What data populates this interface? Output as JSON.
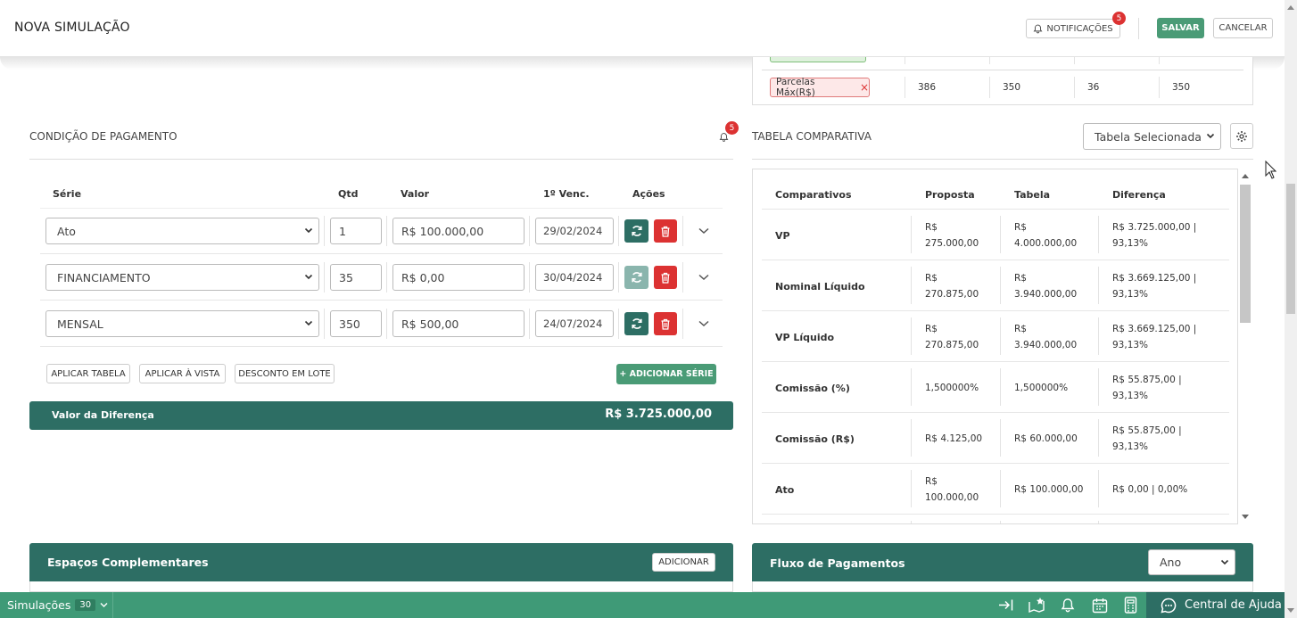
{
  "header": {
    "title": "NOVA SIMULAÇÃO",
    "notifications_label": "NOTIFICAÇÕES",
    "notifications_count": "5",
    "save_label": "SALVAR",
    "cancel_label": "CANCELAR"
  },
  "filters": {
    "chip_label": "Parcelas Máx(R$)",
    "chip_remove": "×",
    "values": [
      "386",
      "350",
      "36",
      "350"
    ]
  },
  "payment": {
    "title": "CONDIÇÃO DE PAGAMENTO",
    "bell_count": "5",
    "columns": {
      "serie": "Série",
      "qtd": "Qtd",
      "valor": "Valor",
      "venc": "1º Venc.",
      "acoes": "Ações"
    },
    "rows": [
      {
        "serie": "Ato",
        "qtd": "1",
        "valor": "R$ 100.000,00",
        "venc": "29/02/2024"
      },
      {
        "serie": "FINANCIAMENTO",
        "qtd": "35",
        "valor": "R$ 0,00",
        "venc": "30/04/2024"
      },
      {
        "serie": "MENSAL",
        "qtd": "350",
        "valor": "R$ 500,00",
        "venc": "24/07/2024"
      }
    ],
    "apply_table_label": "APLICAR TABELA",
    "apply_cash_label": "APLICAR À VISTA",
    "batch_discount_label": "DESCONTO EM LOTE",
    "add_series_label": "+ ADICIONAR SÉRIE",
    "difference_label": "Valor da Diferença",
    "difference_value": "R$ 3.725.000,00"
  },
  "comparison": {
    "title": "TABELA COMPARATIVA",
    "select_value": "Tabela Selecionada",
    "columns": {
      "c1": "Comparativos",
      "c2": "Proposta",
      "c3": "Tabela",
      "c4": "Diferença"
    },
    "rows": [
      {
        "label": "VP",
        "proposta": [
          "R$",
          "275.000,00"
        ],
        "tabela": [
          "R$",
          "4.000.000,00"
        ],
        "diferenca": [
          "R$ 3.725.000,00 |",
          "93,13%"
        ]
      },
      {
        "label": "Nominal Líquido",
        "proposta": [
          "R$",
          "270.875,00"
        ],
        "tabela": [
          "R$",
          "3.940.000,00"
        ],
        "diferenca": [
          "R$ 3.669.125,00 |",
          "93,13%"
        ]
      },
      {
        "label": "VP Líquido",
        "proposta": [
          "R$",
          "270.875,00"
        ],
        "tabela": [
          "R$",
          "3.940.000,00"
        ],
        "diferenca": [
          "R$ 3.669.125,00 |",
          "93,13%"
        ]
      },
      {
        "label": "Comissão (%)",
        "proposta": [
          "1,500000%",
          ""
        ],
        "tabela": [
          "1,500000%",
          ""
        ],
        "diferenca": [
          "R$ 55.875,00 |",
          "93,13%"
        ]
      },
      {
        "label": "Comissão (R$)",
        "proposta": [
          "R$ 4.125,00",
          ""
        ],
        "tabela": [
          "R$ 60.000,00",
          ""
        ],
        "diferenca": [
          "R$ 55.875,00 |",
          "93,13%"
        ]
      },
      {
        "label": "Ato",
        "proposta": [
          "R$",
          "100.000,00"
        ],
        "tabela": [
          "R$ 100.000,00",
          ""
        ],
        "diferenca": [
          "R$ 0,00 | 0,00%",
          ""
        ]
      }
    ]
  },
  "extras": {
    "title": "Espaços Complementares",
    "add_label": "ADICIONAR"
  },
  "flow": {
    "title": "Fluxo de Pagamentos",
    "select_value": "Ano"
  },
  "footer": {
    "simulations_label": "Simulações",
    "simulations_count": "30",
    "help_label": "Central de Ajuda"
  },
  "colors": {
    "primary_dark": "#2d6e64",
    "primary": "#3f9a77",
    "danger": "#dc3232"
  }
}
